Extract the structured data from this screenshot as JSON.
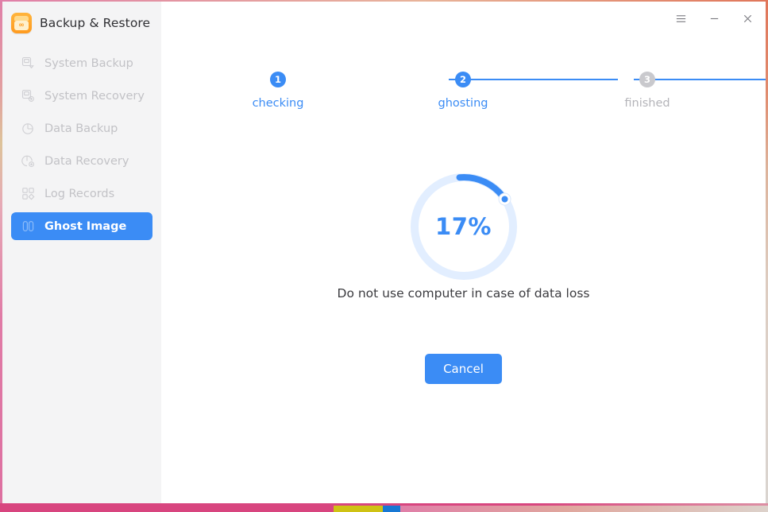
{
  "window": {
    "title": "Backup & Restore",
    "app_icon": "backup-app-icon",
    "accent_color": "#3b8cf5",
    "sidebar_bg": "#f4f4f5",
    "muted_color": "#c2c2c6"
  },
  "window_controls": [
    {
      "name": "menu-button",
      "icon": "hamburger-menu-icon",
      "label": "Menu"
    },
    {
      "name": "minimize-button",
      "icon": "minimize-icon",
      "label": "Minimize"
    },
    {
      "name": "close-button",
      "icon": "close-icon",
      "label": "Close"
    }
  ],
  "sidebar": {
    "items": [
      {
        "label": "System Backup",
        "icon": "system-backup-icon",
        "active": false
      },
      {
        "label": "System Recovery",
        "icon": "system-recovery-icon",
        "active": false
      },
      {
        "label": "Data Backup",
        "icon": "data-backup-icon",
        "active": false
      },
      {
        "label": "Data Recovery",
        "icon": "data-recovery-icon",
        "active": false
      },
      {
        "label": "Log Records",
        "icon": "log-records-icon",
        "active": false
      },
      {
        "label": "Ghost Image",
        "icon": "ghost-image-icon",
        "active": true
      }
    ]
  },
  "stepper": {
    "steps": [
      {
        "number": "1",
        "label": "checking",
        "state": "done"
      },
      {
        "number": "2",
        "label": "ghosting",
        "state": "current"
      },
      {
        "number": "3",
        "label": "finished",
        "state": "todo"
      }
    ]
  },
  "progress": {
    "percent_label": "17%",
    "percent_value": 17,
    "track_color": "#e2eeff",
    "arc_color": "#3b8cf5"
  },
  "main": {
    "hint": "Do not use computer in case of data loss",
    "cancel_label": "Cancel"
  },
  "bottom_strip": {
    "segments": [
      "#d8457f",
      "#cfc214",
      "#1878d4",
      "#e0a79e"
    ]
  }
}
